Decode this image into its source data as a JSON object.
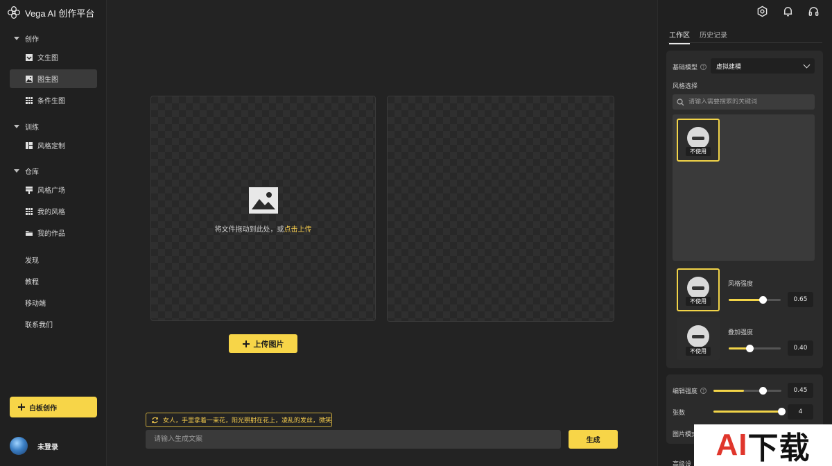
{
  "app": {
    "title": "Vega AI 创作平台"
  },
  "sidebar": {
    "sections": [
      {
        "label": "创作",
        "items": [
          {
            "label": "文生图"
          },
          {
            "label": "图生图"
          },
          {
            "label": "条件生图"
          }
        ]
      },
      {
        "label": "训练",
        "items": [
          {
            "label": "风格定制"
          }
        ]
      },
      {
        "label": "仓库",
        "items": [
          {
            "label": "风格广场"
          },
          {
            "label": "我的风格"
          },
          {
            "label": "我的作品"
          }
        ]
      }
    ],
    "links": [
      "发现",
      "教程",
      "移动端",
      "联系我们"
    ],
    "whiteboard_button": "白板创作",
    "user_name": "未登录"
  },
  "main": {
    "drop_text": "将文件拖动到此处，或",
    "drop_link": "点击上传",
    "upload_button": "上传图片",
    "prompt_suggestion": "女人，手里拿着一束花，阳光照射在花上，凌乱的发丝，微笑",
    "prompt_placeholder": "请输入生成文案",
    "generate_button": "生成"
  },
  "right_panel": {
    "tabs": [
      "工作区",
      "历史记录"
    ],
    "base_model_label": "基础模型",
    "base_model_value": "虚拟建模",
    "style_select_label": "风格选择",
    "search_placeholder": "请输入需要搜索的关键词",
    "unused_label": "不使用",
    "style_strength_label": "风格强度",
    "style_strength_value": "0.65",
    "style_strength_fraction": 0.65,
    "overlay_strength_label": "叠加强度",
    "overlay_strength_value": "0.40",
    "overlay_strength_fraction": 0.4,
    "edit_strength_label": "编辑强度",
    "edit_strength_value": "0.45",
    "edit_strength_fraction": 0.45,
    "count_label": "张数",
    "count_value": "4",
    "image_mode_label": "图片模式",
    "advanced_label": "高级设"
  },
  "watermark": {
    "part1": "AI",
    "part2": "下载"
  },
  "colors": {
    "accent": "#f7d548",
    "background": "#232323",
    "panel": "#2b2b2b"
  }
}
